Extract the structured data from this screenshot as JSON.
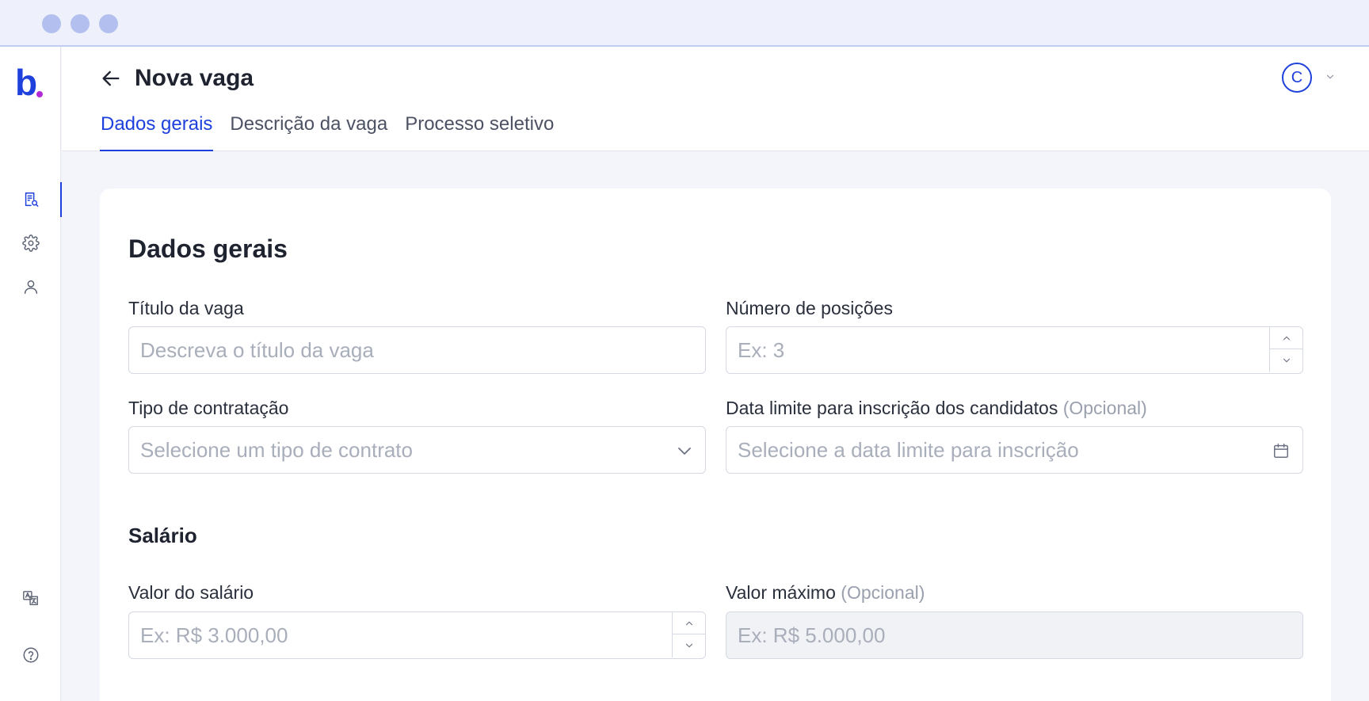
{
  "window": {
    "dots": [
      "dot",
      "dot",
      "dot"
    ]
  },
  "sidebar": {
    "logo": "b",
    "items": [
      {
        "name": "vagas",
        "icon": "document-search-icon",
        "active": true
      },
      {
        "name": "configuracoes",
        "icon": "gear-icon",
        "active": false
      },
      {
        "name": "perfil",
        "icon": "user-icon",
        "active": false
      },
      {
        "name": "idioma",
        "icon": "translate-icon",
        "active": false
      },
      {
        "name": "ajuda",
        "icon": "help-icon",
        "active": false
      }
    ]
  },
  "header": {
    "title": "Nova vaga",
    "back_icon": "arrow-left-icon",
    "avatar_initial": "C",
    "tabs": [
      {
        "label": "Dados gerais",
        "active": true
      },
      {
        "label": "Descrição da vaga",
        "active": false
      },
      {
        "label": "Processo seletivo",
        "active": false
      }
    ]
  },
  "form": {
    "section_title": "Dados gerais",
    "job_title": {
      "label": "Título da vaga",
      "placeholder": "Descreva o título da vaga",
      "value": ""
    },
    "positions": {
      "label": "Número de posições",
      "placeholder": "Ex: 3",
      "value": ""
    },
    "contract_type": {
      "label": "Tipo de contratação",
      "placeholder": "Selecione um tipo de contrato",
      "value": ""
    },
    "deadline": {
      "label": "Data limite para inscrição dos candidatos",
      "optional": "(Opcional)",
      "placeholder": "Selecione a data limite para inscrição",
      "value": ""
    },
    "salary_title": "Salário",
    "salary": {
      "label": "Valor do salário",
      "placeholder": "Ex: R$ 3.000,00",
      "value": ""
    },
    "salary_max": {
      "label": "Valor máximo",
      "optional": "(Opcional)",
      "placeholder": "Ex: R$ 5.000,00",
      "value": ""
    }
  },
  "colors": {
    "accent": "#1e40dc",
    "logo_dot": "#b02bd6",
    "background": "#f3f5fb"
  }
}
